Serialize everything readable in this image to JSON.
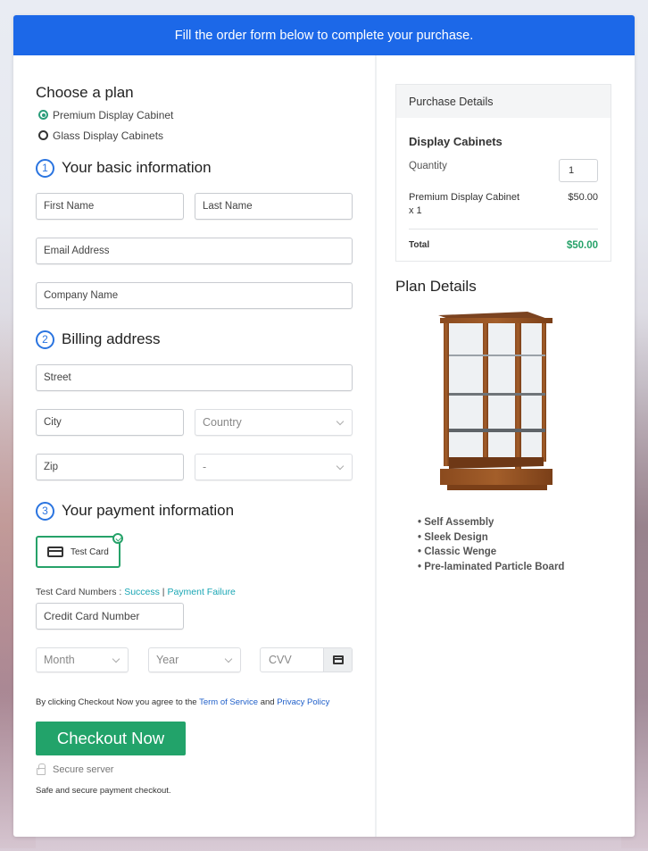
{
  "banner": {
    "text": "Fill the order form below to complete your purchase."
  },
  "plan": {
    "heading": "Choose a plan",
    "options": [
      {
        "label": "Premium Display Cabinet",
        "selected": true
      },
      {
        "label": "Glass Display Cabinets",
        "selected": false
      }
    ]
  },
  "steps": {
    "basic": {
      "number": "1",
      "title": "Your basic information"
    },
    "billing": {
      "number": "2",
      "title": "Billing address"
    },
    "payment": {
      "number": "3",
      "title": "Your payment information"
    }
  },
  "basic_fields": {
    "first_name": "First Name",
    "last_name": "Last Name",
    "email": "Email Address",
    "company": "Company Name"
  },
  "billing_fields": {
    "street": "Street",
    "city": "City",
    "country": "Country",
    "zip": "Zip",
    "state": "-"
  },
  "payment": {
    "method_label": "Test Card",
    "test_numbers_label": "Test Card Numbers : ",
    "success_link": "Success",
    "separator": " | ",
    "failure_link": "Payment Failure",
    "card_number": "Credit Card Number",
    "month": "Month",
    "year": "Year",
    "cvv": "CVV"
  },
  "agreement": {
    "prefix": "By clicking Checkout Now you agree to the ",
    "tos": "Term of Service",
    "and": " and ",
    "privacy": "Privacy Policy"
  },
  "checkout": {
    "button": "Checkout Now",
    "secure": "Secure server",
    "safe": "Safe and secure payment checkout."
  },
  "purchase": {
    "heading": "Purchase Details",
    "product": "Display Cabinets",
    "quantity_label": "Quantity",
    "quantity_value": "1",
    "line_item_name": "Premium Display Cabinet",
    "line_item_qty": "x 1",
    "line_item_price": "$50.00",
    "total_label": "Total",
    "total_value": "$50.00",
    "total_color": "#26a269"
  },
  "plan_details": {
    "heading": "Plan Details",
    "image_alt": "Wooden glass display cabinet",
    "features": [
      "Self Assembly",
      "Sleek Design",
      "Classic Wenge",
      "Pre-laminated Particle Board"
    ]
  },
  "colors": {
    "banner": "#1c68e8",
    "accent_green": "#22a36a",
    "step_blue": "#2a74e0",
    "link_teal": "#1aa6b4"
  }
}
